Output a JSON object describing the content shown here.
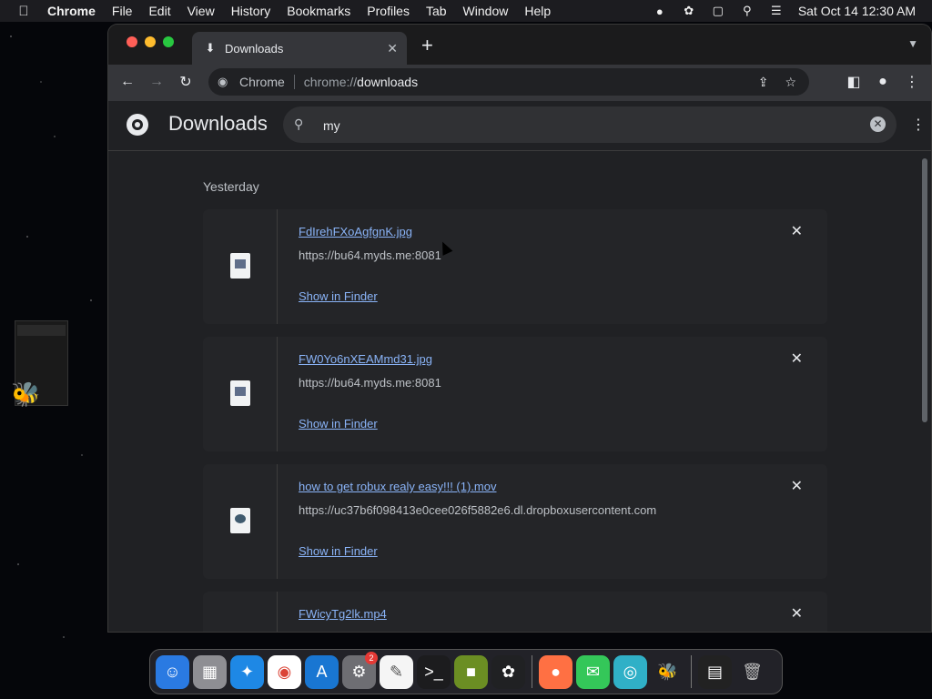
{
  "menubar": {
    "app": "Chrome",
    "items": [
      "File",
      "Edit",
      "View",
      "History",
      "Bookmarks",
      "Profiles",
      "Tab",
      "Window",
      "Help"
    ],
    "clock": "Sat Oct 14  12:30 AM"
  },
  "browser": {
    "tab_title": "Downloads",
    "omnibox": {
      "chip": "Chrome",
      "scheme": "chrome://",
      "path": "downloads"
    }
  },
  "downloads": {
    "title": "Downloads",
    "search_value": "my",
    "section_date": "Yesterday",
    "items": [
      {
        "name": "FdIrehFXoAgfgnK.jpg",
        "url": "https://bu64.myds.me:8081",
        "action": "Show in Finder",
        "icon": "image-file-icon"
      },
      {
        "name": "FW0Yo6nXEAMmd31.jpg",
        "url": "https://bu64.myds.me:8081",
        "action": "Show in Finder",
        "icon": "image-file-icon"
      },
      {
        "name": "how to get robux realy easy!!! (1).mov",
        "url": "https://uc37b6f098413e0cee026f5882e6.dl.dropboxusercontent.com",
        "action": "Show in Finder",
        "icon": "video-file-icon"
      },
      {
        "name": "FWicyTg2lk.mp4",
        "url": "",
        "action": "",
        "icon": "video-file-icon"
      }
    ]
  },
  "dock": {
    "apps": [
      "finder",
      "launchpad",
      "safari",
      "chrome",
      "app-store",
      "system-settings",
      "textedit",
      "terminal",
      "minecraft",
      "chatgpt",
      "firefox",
      "messages",
      "find-my",
      "bee-app",
      "screenshot-thumbnail",
      "trash"
    ],
    "settings_badge": "2"
  }
}
